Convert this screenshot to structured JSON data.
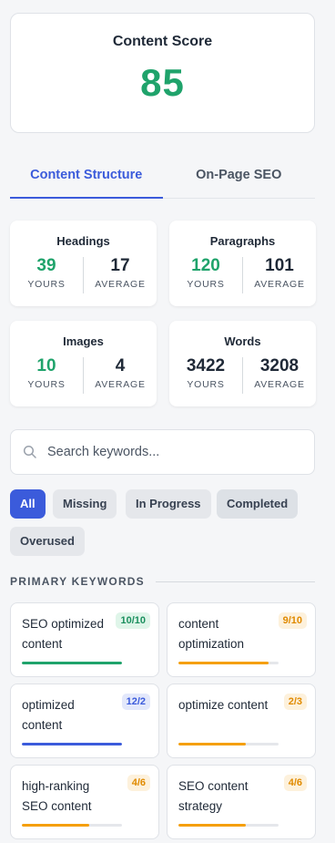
{
  "score": {
    "title": "Content Score",
    "value": "85"
  },
  "tabs": [
    {
      "label": "Content Structure",
      "active": true
    },
    {
      "label": "On-Page SEO",
      "active": false
    }
  ],
  "stats": [
    {
      "title": "Headings",
      "yours": "39",
      "average": "17",
      "yours_highlight": true
    },
    {
      "title": "Paragraphs",
      "yours": "120",
      "average": "101",
      "yours_highlight": true
    },
    {
      "title": "Images",
      "yours": "10",
      "average": "4",
      "yours_highlight": true
    },
    {
      "title": "Words",
      "yours": "3422",
      "average": "3208",
      "yours_highlight": false
    }
  ],
  "stat_labels": {
    "yours": "YOURS",
    "average": "AVERAGE"
  },
  "search": {
    "placeholder": "Search keywords...",
    "value": ""
  },
  "filters": [
    "All",
    "Missing",
    "In Progress",
    "Completed",
    "Overused"
  ],
  "active_filter": "All",
  "section_title": "PRIMARY KEYWORDS",
  "keywords": [
    {
      "name": "SEO optimized content",
      "badge": "10/10",
      "status": "completed",
      "progress": 1.0
    },
    {
      "name": "content optimization",
      "badge": "9/10",
      "status": "in-progress",
      "progress": 0.9
    },
    {
      "name": "optimized content",
      "badge": "12/2",
      "status": "overused",
      "progress": 1.0
    },
    {
      "name": "optimize content",
      "badge": "2/3",
      "status": "in-progress",
      "progress": 0.67
    },
    {
      "name": "high-ranking SEO content",
      "badge": "4/6",
      "status": "in-progress",
      "progress": 0.67
    },
    {
      "name": "SEO content strategy",
      "badge": "4/6",
      "status": "in-progress",
      "progress": 0.67
    }
  ],
  "colors": {
    "accent": "#3b5bdb",
    "score_green": "#1fa36b",
    "completed_bar": "#1fa36b",
    "completed_badge_bg": "#dff5e9",
    "completed_badge_fg": "#1b8f5e",
    "progress_bar": "#f59f0b",
    "progress_badge_bg": "#fdf1dc",
    "progress_badge_fg": "#e08a00",
    "overused_bar": "#3b5bdb",
    "overused_badge_bg": "#e3e8fb",
    "overused_badge_fg": "#3b5bdb"
  }
}
